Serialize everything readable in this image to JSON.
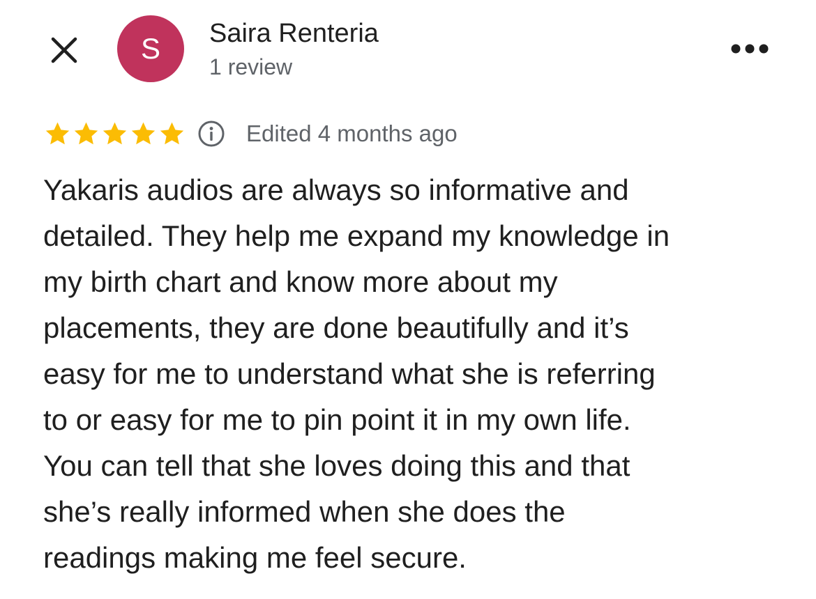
{
  "reviewer": {
    "avatar_letter": "S",
    "avatar_color": "#c0335c",
    "name": "Saira Renteria",
    "review_count": "1 review"
  },
  "rating": {
    "stars": 5,
    "max_stars": 5,
    "star_color": "#fbbc04",
    "edited_label": "Edited 4 months ago"
  },
  "icons": {
    "close": "close-icon",
    "more": "more-options-icon",
    "info": "info-icon",
    "star": "star-icon"
  },
  "review": {
    "lines": [
      "Yakaris audios are always so informative and",
      "detailed. They help me expand my knowledge in",
      "my birth chart and know more about my",
      "placements, they are done beautifully and it’s",
      "easy for me to understand what she is referring",
      "to or easy for me to pin point it in my own life.",
      "You can tell that she loves doing this and that",
      "she’s really informed when she does the",
      "readings making me feel secure."
    ]
  }
}
